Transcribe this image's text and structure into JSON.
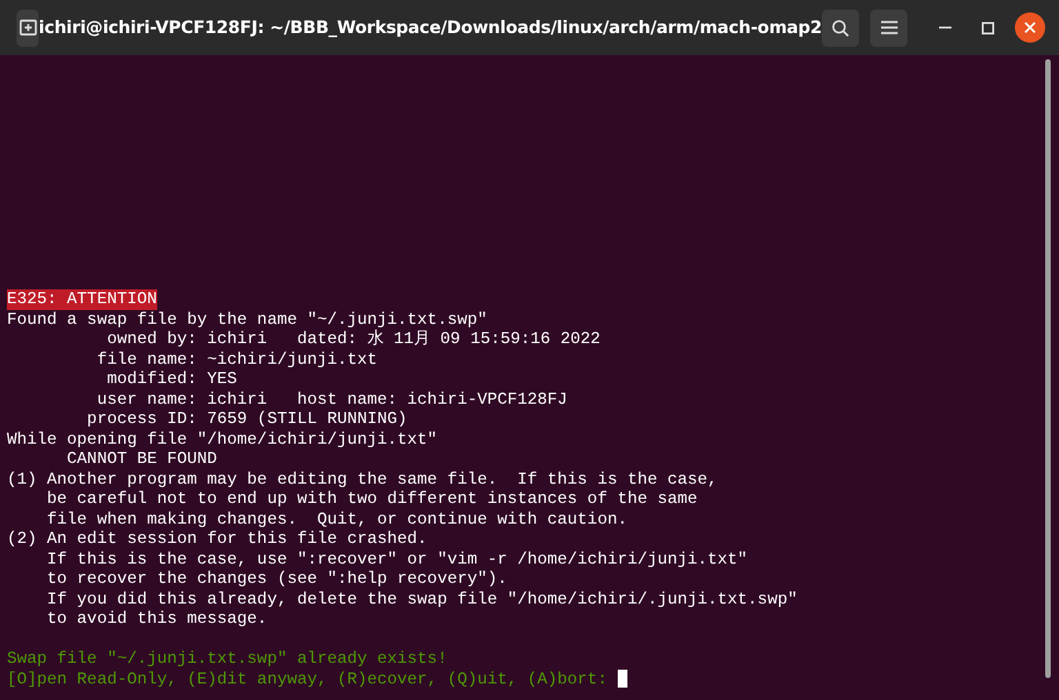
{
  "window": {
    "title": "ichiri@ichiri-VPCF128FJ: ~/BBB_Workspace/Downloads/linux/arch/arm/mach-omap2"
  },
  "terminal": {
    "lines": [
      {
        "kind": "error",
        "text": "E325: ATTENTION"
      },
      {
        "kind": "normal",
        "text": "Found a swap file by the name \"~/.junji.txt.swp\""
      },
      {
        "kind": "normal",
        "text": "          owned by: ichiri   dated: 水 11月 09 15:59:16 2022"
      },
      {
        "kind": "normal",
        "text": "         file name: ~ichiri/junji.txt"
      },
      {
        "kind": "normal",
        "text": "          modified: YES"
      },
      {
        "kind": "normal",
        "text": "         user name: ichiri   host name: ichiri-VPCF128FJ"
      },
      {
        "kind": "normal",
        "text": "        process ID: 7659 (STILL RUNNING)"
      },
      {
        "kind": "normal",
        "text": "While opening file \"/home/ichiri/junji.txt\""
      },
      {
        "kind": "normal",
        "text": "      CANNOT BE FOUND"
      },
      {
        "kind": "normal",
        "text": "(1) Another program may be editing the same file.  If this is the case,"
      },
      {
        "kind": "normal",
        "text": "    be careful not to end up with two different instances of the same"
      },
      {
        "kind": "normal",
        "text": "    file when making changes.  Quit, or continue with caution."
      },
      {
        "kind": "normal",
        "text": "(2) An edit session for this file crashed."
      },
      {
        "kind": "normal",
        "text": "    If this is the case, use \":recover\" or \"vim -r /home/ichiri/junji.txt\""
      },
      {
        "kind": "normal",
        "text": "    to recover the changes (see \":help recovery\")."
      },
      {
        "kind": "normal",
        "text": "    If you did this already, delete the swap file \"/home/ichiri/.junji.txt.swp\""
      },
      {
        "kind": "normal",
        "text": "    to avoid this message."
      },
      {
        "kind": "blank"
      },
      {
        "kind": "prompt",
        "text": "Swap file \"~/.junji.txt.swp\" already exists!"
      },
      {
        "kind": "prompt",
        "text": "[O]pen Read-Only, (E)dit anyway, (R)ecover, (Q)uit, (A)bort: ",
        "cursor": true
      }
    ]
  }
}
